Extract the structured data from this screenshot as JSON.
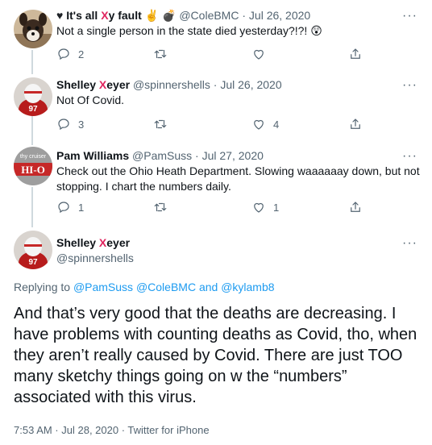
{
  "tweets": [
    {
      "name_pre": "It's all ",
      "name_mark": "X",
      "name_post": "y fault",
      "name_emoji": "✌️ 💣",
      "handle": "@ColeBMC",
      "date": "Jul 26, 2020",
      "text": "Not a single person in the state died yesterday?!?! 😲",
      "replies": "2",
      "retweets": "",
      "likes": ""
    },
    {
      "name_pre": "Shelley ",
      "name_mark": "X",
      "name_post": "eyer",
      "handle": "@spinnershells",
      "date": "Jul 26, 2020",
      "text": "Not Of Covid.",
      "replies": "3",
      "retweets": "",
      "likes": "4"
    },
    {
      "name": "Pam Williams",
      "handle": "@PamSuss",
      "date": "Jul 27, 2020",
      "text": "Check out the Ohio Heath Department.  Slowing waaaaaay down,  but not stopping.   I chart the numbers daily.",
      "replies": "1",
      "retweets": "",
      "likes": "1"
    }
  ],
  "main": {
    "name_pre": "Shelley ",
    "name_mark": "X",
    "name_post": "eyer",
    "handle": "@spinnershells",
    "replying_prefix": "Replying to ",
    "replying_to": "@PamSuss @ColeBMC and @kylamb8",
    "text": "And that’s very good that the deaths are decreasing. I have problems with counting deaths as Covid, tho, when they aren’t really caused by Covid. There are just TOO many sketchy things going on w the “numbers” associated with this virus.",
    "meta": "7:53 AM · Jul 28, 2020 · Twitter for iPhone"
  },
  "ui": {
    "dot": "·",
    "more": "···"
  },
  "colors": {
    "link": "#1d9bf0",
    "secondary": "#536471",
    "name_x": "#e0245e"
  },
  "icons": [
    "reply-icon",
    "retweet-icon",
    "like-icon",
    "share-icon",
    "more-icon",
    "heart-emoji-icon"
  ]
}
